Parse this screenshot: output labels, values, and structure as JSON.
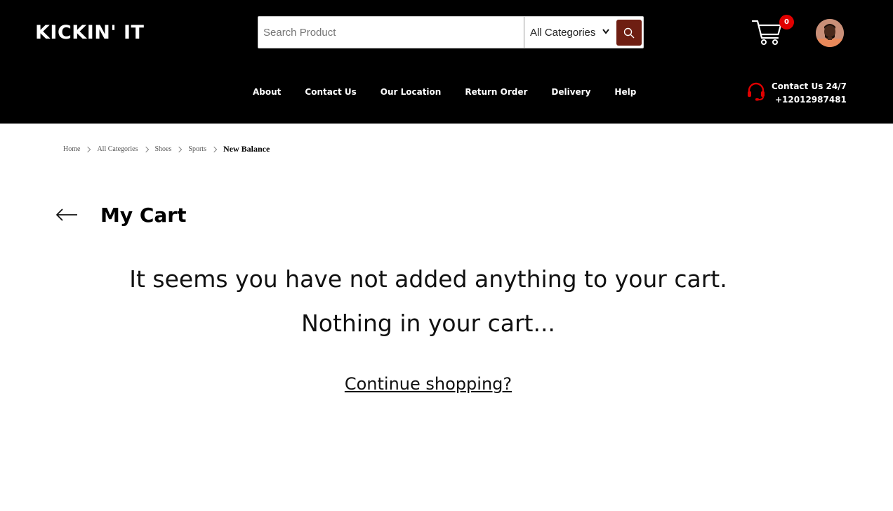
{
  "brand": {
    "logo_text": "KICKIN' IT"
  },
  "search": {
    "placeholder": "Search Product",
    "value": "",
    "category": "All Categories",
    "button_icon": "search-icon"
  },
  "cart": {
    "icon": "cart-icon",
    "count": "0"
  },
  "user": {
    "avatar_icon": "user-avatar"
  },
  "nav": {
    "items": [
      {
        "label": "About"
      },
      {
        "label": "Contact Us"
      },
      {
        "label": "Our Location"
      },
      {
        "label": "Return Order"
      },
      {
        "label": "Delivery"
      },
      {
        "label": "Help"
      }
    ]
  },
  "support": {
    "icon": "headset-icon",
    "title": "Contact Us 24/7",
    "phone": "+12012987481"
  },
  "breadcrumb": {
    "items": [
      {
        "label": "Home"
      },
      {
        "label": "All Categories"
      },
      {
        "label": "Shoes"
      },
      {
        "label": "Sports"
      }
    ],
    "current": "New Balance"
  },
  "main": {
    "back_icon": "arrow-left-icon",
    "title": "My Cart",
    "empty_message": "It seems you have not added anything to your cart.",
    "empty_sub": "Nothing in your cart...",
    "continue_link": "Continue shopping?"
  },
  "colors": {
    "header_bg": "#000000",
    "search_button": "#6e1e12",
    "badge": "#e00000",
    "support_icon": "#e00000"
  }
}
